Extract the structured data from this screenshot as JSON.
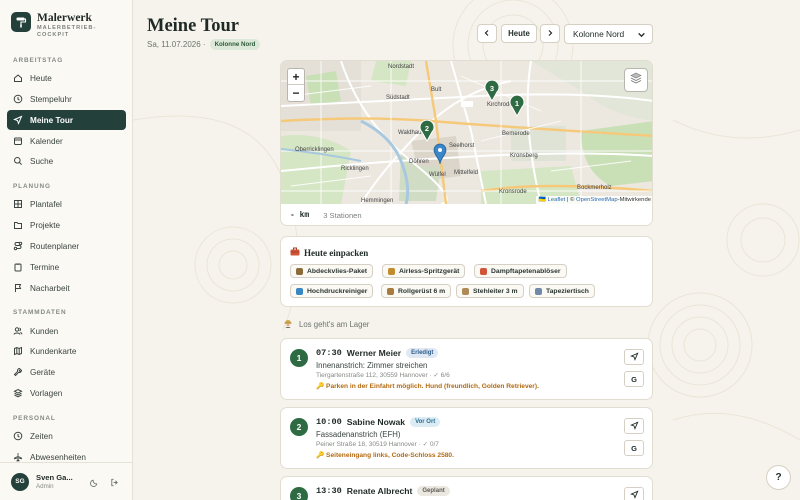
{
  "brand": {
    "title": "Malerwerk",
    "subtitle_line1": "MALERBETRIEB-",
    "subtitle_line2": "COCKPIT"
  },
  "sidebar": {
    "sections": [
      {
        "label": "ARBEITSTAG",
        "items": [
          {
            "label": "Heute",
            "icon": "home-icon"
          },
          {
            "label": "Stempeluhr",
            "icon": "clock-icon"
          },
          {
            "label": "Meine Tour",
            "icon": "navigation-icon",
            "active": true
          },
          {
            "label": "Kalender",
            "icon": "calendar-icon"
          },
          {
            "label": "Suche",
            "icon": "search-icon"
          }
        ]
      },
      {
        "label": "PLANUNG",
        "items": [
          {
            "label": "Plantafel",
            "icon": "grid-icon"
          },
          {
            "label": "Projekte",
            "icon": "folder-icon"
          },
          {
            "label": "Routenplaner",
            "icon": "route-icon"
          },
          {
            "label": "Termine",
            "icon": "clipboard-icon"
          },
          {
            "label": "Nacharbeit",
            "icon": "flag-icon"
          }
        ]
      },
      {
        "label": "STAMMDATEN",
        "items": [
          {
            "label": "Kunden",
            "icon": "users-icon"
          },
          {
            "label": "Kundenkarte",
            "icon": "map-icon"
          },
          {
            "label": "Geräte",
            "icon": "wrench-icon"
          },
          {
            "label": "Vorlagen",
            "icon": "layers-icon"
          }
        ]
      },
      {
        "label": "PERSONAL",
        "items": [
          {
            "label": "Zeiten",
            "icon": "clock-icon"
          },
          {
            "label": "Abwesenheiten",
            "icon": "plane-icon"
          }
        ]
      }
    ]
  },
  "user": {
    "initials": "SG",
    "name": "Sven Ga...",
    "role": "Admin"
  },
  "header": {
    "title": "Meine Tour",
    "date": "Sa, 11.07.2026 ·",
    "crew_badge": "Kolonne Nord",
    "today_label": "Heute",
    "crew_select": "Kolonne Nord"
  },
  "map": {
    "zoom_in": "+",
    "zoom_out": "−",
    "attribution_leaflet": "Leaflet",
    "attribution_osm": "OpenStreetMap",
    "attribution_rest": "-Mitwirkende",
    "labels": [
      "Nordstadt",
      "Südstadt",
      "Kirchrode",
      "Bemerode",
      "Kronsberg",
      "Seelhorst",
      "Döhren",
      "Wülfel",
      "Mittelfeld",
      "Waldhausen",
      "Oberricklingen",
      "Ricklingen",
      "Hemmingen",
      "Bult",
      "Kronsrode",
      "Bockmerholz"
    ],
    "markers": [
      "3",
      "1",
      "2"
    ],
    "distance": "- km",
    "stations": "3 Stationen"
  },
  "pack": {
    "title": "Heute einpacken",
    "items": [
      {
        "label": "Abdeckvlies-Paket",
        "color": "#8b6b3a"
      },
      {
        "label": "Airless-Spritzgerät",
        "color": "#c28b2e"
      },
      {
        "label": "Dampftapetenablöser",
        "color": "#d2553a"
      },
      {
        "label": "Hochdruckreiniger",
        "color": "#3a86c2"
      },
      {
        "label": "Rollgerüst 6 m",
        "color": "#a87a3c"
      },
      {
        "label": "Stehleiter 3 m",
        "color": "#b08a56"
      },
      {
        "label": "Tapeziertisch",
        "color": "#6f8aa8"
      }
    ]
  },
  "depot": {
    "label": "Los geht's am Lager"
  },
  "stops": [
    {
      "num": "1",
      "time": "07:30",
      "customer": "Werner Meier",
      "status": "Erledigt",
      "status_bg": "#dfe8f3",
      "status_fg": "#2a5d8c",
      "job": "Innenanstrich: Zimmer streichen",
      "address": "Tiergartenstraße 112, 30559 Hannover · ✓ 6/6",
      "note": "🔑 Parken in der Einfahrt möglich. Hund (freundlich, Golden Retriever).",
      "g": "G"
    },
    {
      "num": "2",
      "time": "10:00",
      "customer": "Sabine Nowak",
      "status": "Vor Ort",
      "status_bg": "#dcecf5",
      "status_fg": "#2a6d8c",
      "job": "Fassadenanstrich (EFH)",
      "address": "Peiner Straße 18, 30519 Hannover · ✓ 0/7",
      "note": "🔑 Seiteneingang links, Code-Schloss 2580.",
      "g": "G"
    },
    {
      "num": "3",
      "time": "13:30",
      "customer": "Renate Albrecht",
      "status": "Geplant",
      "status_bg": "#ebe8e1",
      "status_fg": "#5e5a52"
    }
  ],
  "help": "?"
}
